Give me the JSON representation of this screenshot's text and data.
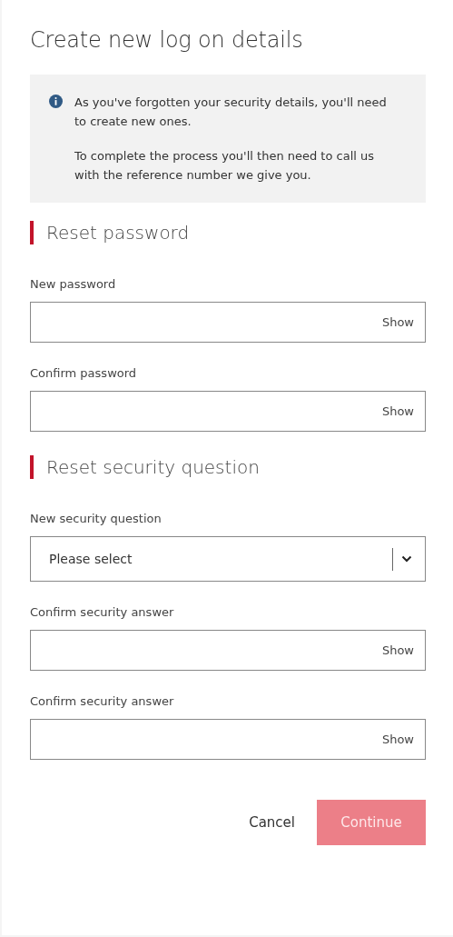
{
  "title": "Create new log on details",
  "notice": {
    "paragraphs": [
      "As you've forgotten your security details, you'll need to create new ones.",
      "To complete the process you'll then need to call us with the reference number we give you."
    ]
  },
  "sections": [
    {
      "heading": "Reset password",
      "fields": [
        {
          "kind": "password",
          "label": "New password",
          "toggle": "Show"
        },
        {
          "kind": "password",
          "label": "Confirm password",
          "toggle": "Show"
        }
      ]
    },
    {
      "heading": "Reset security question",
      "fields": [
        {
          "kind": "select",
          "label": "New security question",
          "placeholder": "Please select"
        },
        {
          "kind": "password",
          "label": "Confirm security answer",
          "toggle": "Show"
        },
        {
          "kind": "password",
          "label": "Confirm security answer",
          "toggle": "Show"
        }
      ]
    }
  ],
  "actions": {
    "cancel": "Cancel",
    "continue": {
      "label": "Continue",
      "disabled": true
    }
  }
}
